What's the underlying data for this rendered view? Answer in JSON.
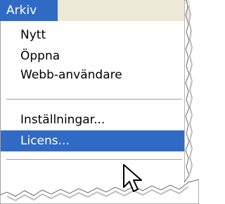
{
  "menubar": {
    "active_menu_label": "Arkiv"
  },
  "dropdown": {
    "items": [
      {
        "label": "Nytt"
      },
      {
        "label": "Öppna"
      },
      {
        "label": "Webb-användare"
      },
      {
        "label": "Inställningar..."
      },
      {
        "label": "Licens...",
        "highlighted": true
      }
    ]
  },
  "colors": {
    "highlight": "#316ac5",
    "menu_bg": "#ffffff",
    "separator": "#a0a0a0"
  },
  "icons": {
    "cursor": "arrow-cursor-icon"
  }
}
